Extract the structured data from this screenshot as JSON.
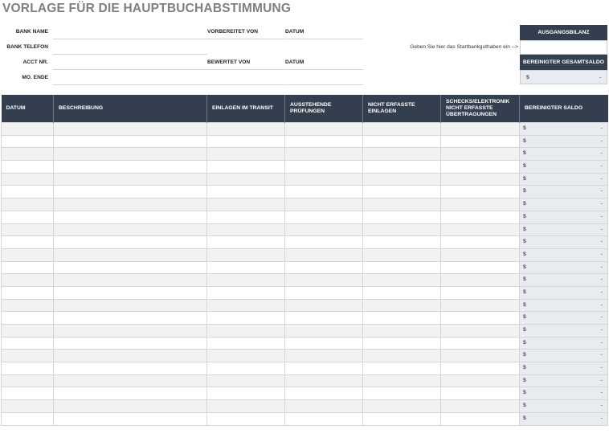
{
  "title": "VORLAGE FÜR DIE HAUPTBUCHABSTIMMUNG",
  "info": {
    "bank_name": "BANK NAME",
    "bank_phone": "BANK TELEFON",
    "acct_nr": "ACCT NR.",
    "mo_end": "MO. ENDE",
    "prepared_by": "VORBEREITET VON",
    "reviewed_by": "BEWERTET VON",
    "date1": "DATUM",
    "date2": "DATUM",
    "hint": "Geben Sie hier das Startbankguthaben ein -->"
  },
  "balance_box": {
    "opening_label": "AUSGANGSBILANZ",
    "adjusted_total_label": "BEREINIGTER GESAMTSALDO",
    "currency": "$",
    "adjusted_total_value": "-"
  },
  "table": {
    "headers": [
      "DATUM",
      "BESCHREIBUNG",
      "EINLAGEN IM TRANSIT",
      "AUSSTEHENDE PRÜFUNGEN",
      "NICHT ERFASSTE EINLAGEN",
      "SCHECKS/ELEKTRONIK NICHT ERFASSTE ÜBERTRAGUNGEN",
      "BEREINIGTER SALDO"
    ],
    "row_currency": "$",
    "rows": [
      "-",
      "-",
      "-",
      "-",
      "-",
      "-",
      "-",
      "-",
      "-",
      "-",
      "-",
      "-",
      "-",
      "-",
      "-",
      "-",
      "-",
      "-",
      "-",
      "-",
      "-",
      "-",
      "-",
      "-"
    ]
  },
  "colors": {
    "header_bg": "#333f4f",
    "saldo_bg": "#e8ecf1",
    "title": "#7f7f7f"
  }
}
